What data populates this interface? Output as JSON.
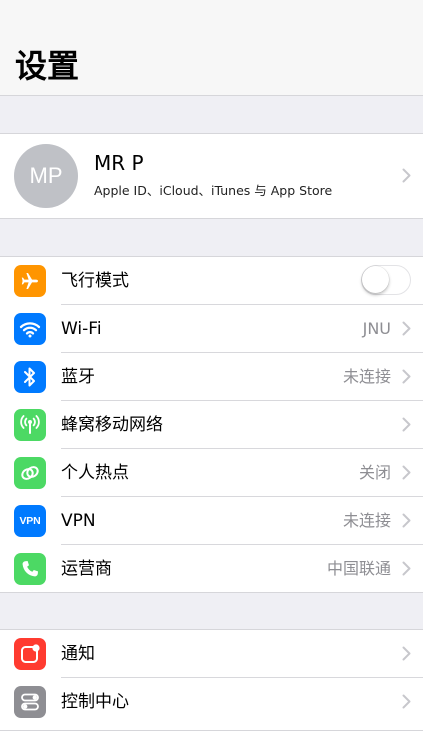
{
  "header": {
    "title": "设置"
  },
  "profile": {
    "initials": "MP",
    "name": "MR P",
    "subtitle": "Apple ID、iCloud、iTunes 与 App Store"
  },
  "group1": [
    {
      "key": "airplane",
      "label": "飞行模式",
      "value": "",
      "icon": "airplane-icon",
      "color": "#ff9500",
      "toggle": true,
      "toggle_on": false
    },
    {
      "key": "wifi",
      "label": "Wi-Fi",
      "value": "JNU",
      "icon": "wifi-icon",
      "color": "#007aff"
    },
    {
      "key": "bluetooth",
      "label": "蓝牙",
      "value": "未连接",
      "icon": "bluetooth-icon",
      "color": "#007aff"
    },
    {
      "key": "cellular",
      "label": "蜂窝移动网络",
      "value": "",
      "icon": "cellular-antenna-icon",
      "color": "#4cd964"
    },
    {
      "key": "hotspot",
      "label": "个人热点",
      "value": "关闭",
      "icon": "hotspot-link-icon",
      "color": "#4cd964"
    },
    {
      "key": "vpn",
      "label": "VPN",
      "value": "未连接",
      "icon": "vpn-icon",
      "color": "#007aff",
      "icon_text": "VPN"
    },
    {
      "key": "carrier",
      "label": "运营商",
      "value": "中国联通",
      "icon": "phone-icon",
      "color": "#4cd964"
    }
  ],
  "group2": [
    {
      "key": "notifications",
      "label": "通知",
      "value": "",
      "icon": "notifications-icon",
      "color": "#ff3b30"
    },
    {
      "key": "control-center",
      "label": "控制中心",
      "value": "",
      "icon": "control-center-icon",
      "color": "#8e8e93"
    }
  ]
}
